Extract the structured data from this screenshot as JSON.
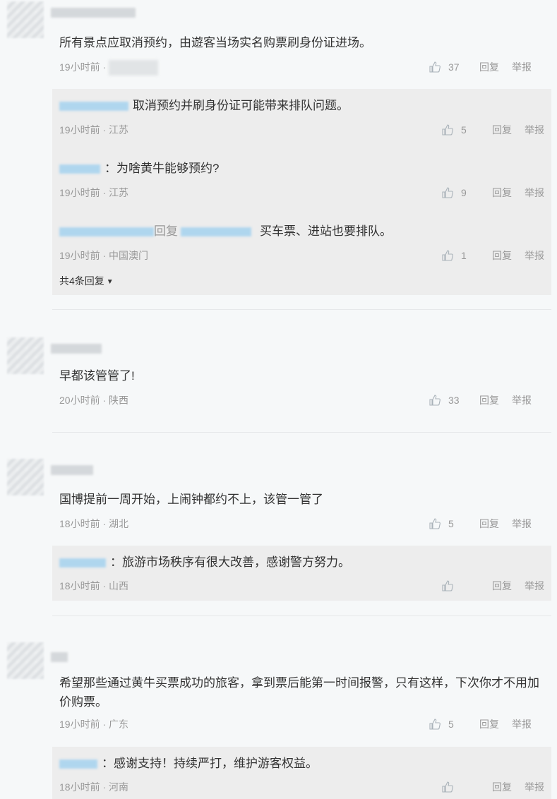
{
  "comments": [
    {
      "content": "所有景点应取消预约，由遊客当场实名购票刷身份证进场。",
      "time": "19小时前 ·",
      "likes": "37",
      "replies": [
        {
          "content": "取消预约并刷身份证可能带来排队问题。",
          "meta": "19小时前 · 江苏",
          "likes": "5"
        },
        {
          "content": "：为啥黄牛能够预约?",
          "meta": "19小时前 · 江苏",
          "likes": "9"
        },
        {
          "prefix": "回复",
          "content": "买车票、进站也要排队。",
          "meta": "19小时前 · 中国澳门",
          "likes": "1"
        }
      ],
      "more_label": "共4条回复"
    },
    {
      "content": "早都该管管了!",
      "meta": "20小时前 · 陕西",
      "likes": "33",
      "replies": []
    },
    {
      "content": "国博提前一周开始，上闹钟都约不上，该管一管了",
      "meta": "18小时前 · 湖北",
      "likes": "5",
      "replies": [
        {
          "content": "：旅游市场秩序有很大改善，感谢警方努力。",
          "meta": "18小时前 · 山西",
          "likes": ""
        }
      ]
    },
    {
      "content": "希望那些通过黄牛买票成功的旅客，拿到票后能第一时间报警，只有这样，下次你才不用加价购票。",
      "meta": "19小时前 · 广东",
      "likes": "5",
      "replies": [
        {
          "content": "：感谢支持！持续严打，维护游客权益。",
          "meta": "18小时前 · 河南",
          "likes": ""
        }
      ]
    }
  ],
  "labels": {
    "reply": "回复",
    "report": "举报"
  },
  "icons": {
    "like": "thumbs-up-icon",
    "caret": "caret-down-icon"
  }
}
